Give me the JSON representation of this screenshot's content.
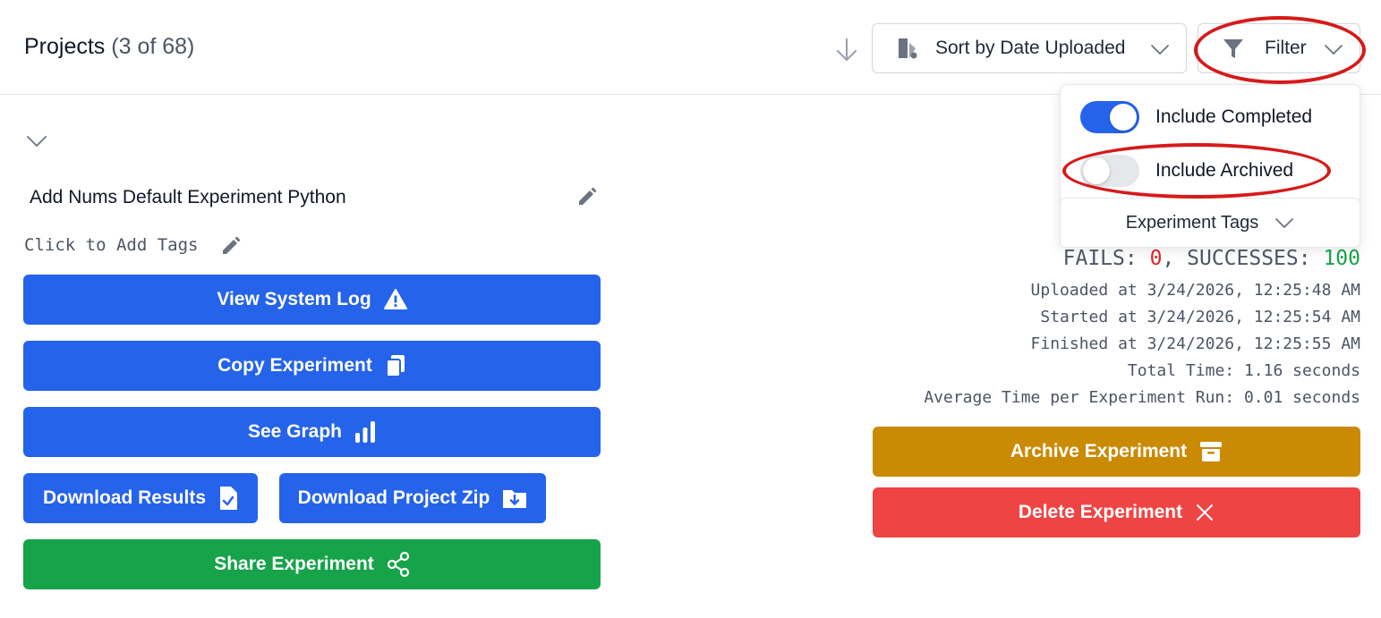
{
  "header": {
    "title": "Projects",
    "count": "(3 of 68)",
    "sort_label": "Sort by Date Uploaded",
    "filter_label": "Filter"
  },
  "filter_menu": {
    "include_completed": {
      "label": "Include Completed",
      "checked": true
    },
    "include_archived": {
      "label": "Include Archived",
      "checked": false
    },
    "experiment_tags_label": "Experiment Tags"
  },
  "experiment": {
    "name": "Add Nums Default Experiment Python",
    "tags_placeholder": "Click to Add Tags",
    "buttons": {
      "view_system_log": "View System Log",
      "copy_experiment": "Copy Experiment",
      "see_graph": "See Graph",
      "download_results": "Download Results",
      "download_project_zip": "Download Project Zip",
      "share_experiment": "Share Experiment",
      "archive_experiment": "Archive Experiment",
      "delete_experiment": "Delete Experiment"
    },
    "stats": {
      "fails_label": "FAILS: ",
      "fails_value": "0",
      "separator": ", SUCCESSES: ",
      "successes_value": "100",
      "uploaded": "Uploaded at 3/24/2026, 12:25:48 AM",
      "started": "Started at 3/24/2026, 12:25:54 AM",
      "finished": "Finished at 3/24/2026, 12:25:55 AM",
      "total_time": "Total Time: 1.16 seconds",
      "average_time": "Average Time per Experiment Run: 0.01 seconds"
    }
  },
  "colors": {
    "primary": "#2563eb",
    "success": "#16a34a",
    "warning": "#ca8a04",
    "danger": "#ef4444",
    "annotation": "#d61a1a"
  },
  "icons": [
    "arrow-down-icon",
    "sort-icon",
    "chevron-down-icon",
    "filter-icon",
    "edit-icon",
    "warning-icon",
    "copy-icon",
    "bar-chart-icon",
    "file-check-icon",
    "folder-download-icon",
    "share-icon",
    "archive-icon",
    "close-icon"
  ]
}
